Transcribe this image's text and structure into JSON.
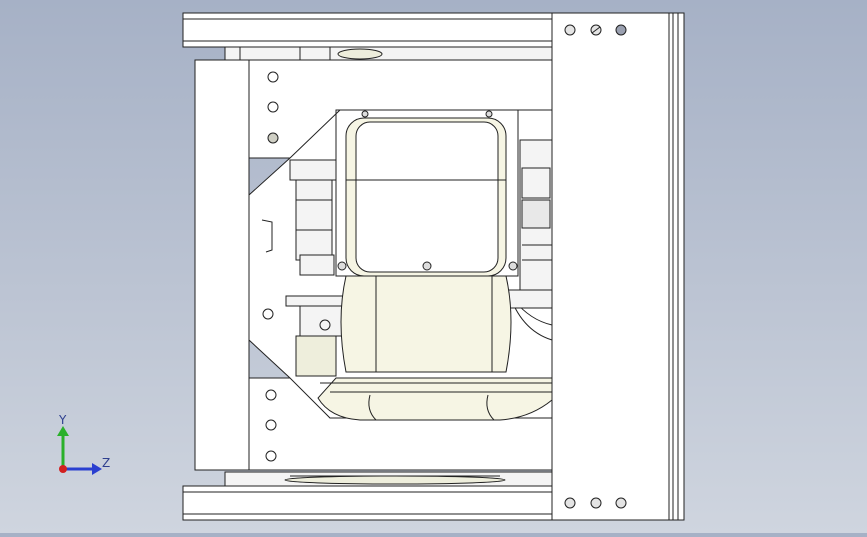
{
  "viewport": {
    "name": "cad-3d-viewport",
    "background_top": "#a6b1c6",
    "background_bottom": "#cfd5df",
    "line_color": "#222222",
    "part_fill": "#ffffff",
    "highlight_fill": "#f3f2d8"
  },
  "model": {
    "description_icon": "assembly-motor-frame",
    "view": "side-orthographic"
  },
  "triad": {
    "y_label": "Y",
    "z_label": "Z",
    "x_color": "#d22020",
    "y_color": "#2ab02a",
    "z_color": "#2a3fd0"
  }
}
